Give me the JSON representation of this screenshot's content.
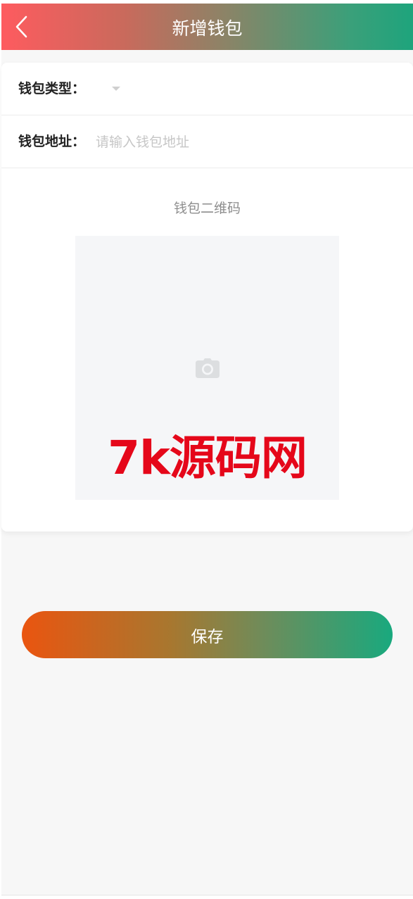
{
  "navbar": {
    "back_icon": "chevron-left-icon",
    "title": "新增钱包"
  },
  "form": {
    "wallet_type": {
      "label": "钱包类型：",
      "selected_value": "",
      "dropdown_icon": "caret-down-icon"
    },
    "wallet_address": {
      "label": "钱包地址：",
      "value": "",
      "placeholder": "请输入钱包地址"
    },
    "qr_code": {
      "title": "钱包二维码",
      "upload_icon": "camera-icon",
      "watermark": "7k源码网"
    }
  },
  "actions": {
    "save_label": "保存"
  },
  "colors": {
    "navbar_gradient": [
      "#fe5b5f",
      "#1ea47c"
    ],
    "save_gradient": [
      "#ea5510",
      "#19a97e"
    ],
    "watermark": "#e5071a",
    "placeholder": "#c6c6c6",
    "page_background": "#f7f7f7"
  }
}
